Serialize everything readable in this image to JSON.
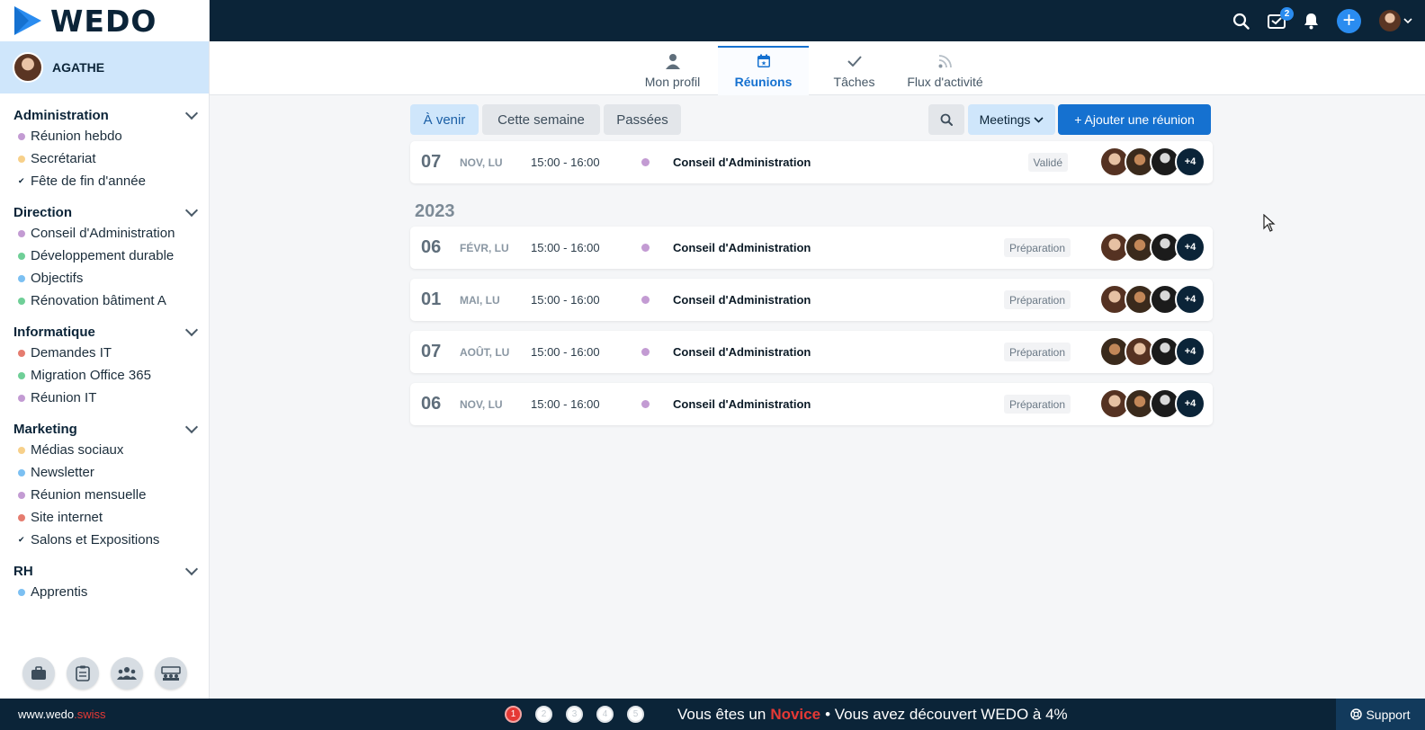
{
  "brand": {
    "logo_text": "WEDO"
  },
  "user": {
    "name": "AGATHE"
  },
  "sidebar": {
    "groups": [
      {
        "title": "Administration",
        "items": [
          {
            "label": "Réunion hebdo",
            "color": "#c39bd3",
            "marker": "dot"
          },
          {
            "label": "Secrétariat",
            "color": "#f7d08a",
            "marker": "dot"
          },
          {
            "label": "Fête de fin d'année",
            "color": "#0b2438",
            "marker": "check"
          }
        ]
      },
      {
        "title": "Direction",
        "items": [
          {
            "label": "Conseil d'Administration",
            "color": "#c39bd3",
            "marker": "dot"
          },
          {
            "label": "Développement durable",
            "color": "#6fcf97",
            "marker": "dot"
          },
          {
            "label": "Objectifs",
            "color": "#7cc0f2",
            "marker": "dot"
          },
          {
            "label": "Rénovation bâtiment A",
            "color": "#6fcf97",
            "marker": "dot"
          }
        ]
      },
      {
        "title": "Informatique",
        "items": [
          {
            "label": "Demandes IT",
            "color": "#e57c6f",
            "marker": "dot"
          },
          {
            "label": "Migration Office 365",
            "color": "#6fcf97",
            "marker": "dot"
          },
          {
            "label": "Réunion IT",
            "color": "#c39bd3",
            "marker": "dot"
          }
        ]
      },
      {
        "title": "Marketing",
        "items": [
          {
            "label": "Médias sociaux",
            "color": "#f7d08a",
            "marker": "dot"
          },
          {
            "label": "Newsletter",
            "color": "#7cc0f2",
            "marker": "dot"
          },
          {
            "label": "Réunion mensuelle",
            "color": "#c39bd3",
            "marker": "dot"
          },
          {
            "label": "Site internet",
            "color": "#e57c6f",
            "marker": "dot"
          },
          {
            "label": "Salons et Expositions",
            "color": "#0b2438",
            "marker": "check"
          }
        ]
      },
      {
        "title": "RH",
        "items": [
          {
            "label": "Apprentis",
            "color": "#7cc0f2",
            "marker": "dot"
          }
        ]
      }
    ]
  },
  "topbar": {
    "tasks_badge": "2"
  },
  "tabs": [
    {
      "label": "Mon profil",
      "icon": "user-icon",
      "active": false
    },
    {
      "label": "Réunions",
      "icon": "calendar-icon",
      "active": true
    },
    {
      "label": "Tâches",
      "icon": "check-icon",
      "active": false
    },
    {
      "label": "Flux d'activité",
      "icon": "rss-icon",
      "active": false
    }
  ],
  "filters": {
    "upcoming": "À venir",
    "this_week": "Cette semaine",
    "past": "Passées",
    "view": "Meetings",
    "add": "+ Ajouter une réunion"
  },
  "meetings_top": [
    {
      "day": "07",
      "date": "NOV, LU",
      "time": "15:00 - 16:00",
      "title": "Conseil d'Administration",
      "status": "Validé",
      "more": "+4",
      "avatars": [
        "f",
        "m",
        "s"
      ]
    }
  ],
  "year_label": "2023",
  "meetings": [
    {
      "day": "06",
      "date": "FÉVR, LU",
      "time": "15:00 - 16:00",
      "title": "Conseil d'Administration",
      "status": "Préparation",
      "more": "+4",
      "avatars": [
        "f",
        "m",
        "s"
      ]
    },
    {
      "day": "01",
      "date": "MAI, LU",
      "time": "15:00 - 16:00",
      "title": "Conseil d'Administration",
      "status": "Préparation",
      "more": "+4",
      "avatars": [
        "f",
        "m",
        "s"
      ]
    },
    {
      "day": "07",
      "date": "AOÛT, LU",
      "time": "15:00 - 16:00",
      "title": "Conseil d'Administration",
      "status": "Préparation",
      "more": "+4",
      "avatars": [
        "m",
        "f",
        "s"
      ]
    },
    {
      "day": "06",
      "date": "NOV, LU",
      "time": "15:00 - 16:00",
      "title": "Conseil d'Administration",
      "status": "Préparation",
      "more": "+4",
      "avatars": [
        "f",
        "m",
        "s"
      ]
    }
  ],
  "footer": {
    "url_main": "www.wedo",
    "url_ext": ".swiss",
    "steps": [
      "1",
      "2",
      "3",
      "4",
      "5"
    ],
    "msg_before": "Vous êtes un",
    "level": "Novice",
    "msg_after": "• Vous avez découvert WEDO à 4%",
    "support": "Support"
  }
}
